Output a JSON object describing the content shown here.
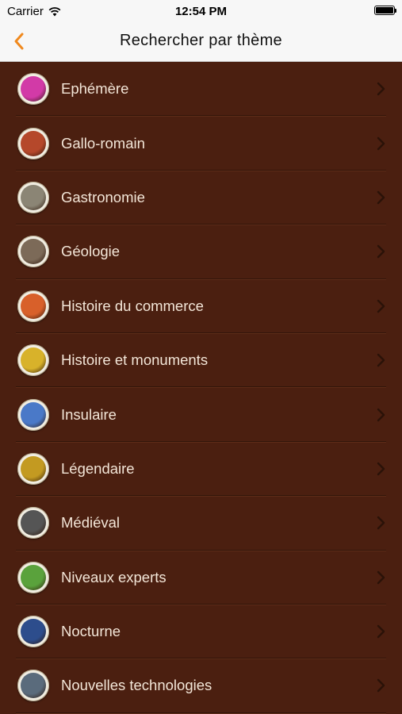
{
  "status": {
    "carrier": "Carrier",
    "time": "12:54 PM",
    "battery_level": 1.0
  },
  "nav": {
    "title": "Rechercher par thème",
    "accent": "#f0891e"
  },
  "themes": [
    {
      "label": "Ephémère",
      "icon": "pink-creature-icon",
      "color": "#d23aa7"
    },
    {
      "label": "Gallo-romain",
      "icon": "gallo-roman-helmet-icon",
      "color": "#b5482b"
    },
    {
      "label": "Gastronomie",
      "icon": "chef-mouse-icon",
      "color": "#8b8575"
    },
    {
      "label": "Géologie",
      "icon": "miner-helmet-icon",
      "color": "#7c6a58"
    },
    {
      "label": "Histoire du commerce",
      "icon": "merchant-fox-icon",
      "color": "#d8602a"
    },
    {
      "label": "Histoire et monuments",
      "icon": "monument-icon",
      "color": "#d8b22a"
    },
    {
      "label": "Insulaire",
      "icon": "island-sail-icon",
      "color": "#4a79c8"
    },
    {
      "label": "Légendaire",
      "icon": "legendary-emblem-icon",
      "color": "#c39a21"
    },
    {
      "label": "Médiéval",
      "icon": "knight-helmet-icon",
      "color": "#555555"
    },
    {
      "label": "Niveaux experts",
      "icon": "green-monster-icon",
      "color": "#5aa23c"
    },
    {
      "label": "Nocturne",
      "icon": "night-owl-icon",
      "color": "#2d4d8c"
    },
    {
      "label": "Nouvelles technologies",
      "icon": "robot-icon",
      "color": "#5a6b7c"
    }
  ]
}
